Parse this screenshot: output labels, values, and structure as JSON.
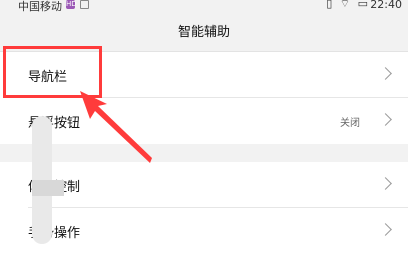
{
  "status_bar": {
    "carrier": "中国移动",
    "hd_badge": "HD",
    "right_icons": "▯ ⌔ ▭",
    "time": "22:40"
  },
  "page": {
    "title": "智能辅助"
  },
  "rows": [
    {
      "label": "导航栏",
      "value": ""
    },
    {
      "label": "悬浮按钮",
      "value": "关闭"
    },
    {
      "label": "体感控制",
      "value": ""
    },
    {
      "label": "手势操作",
      "value": ""
    }
  ],
  "annotation": {
    "highlight_color": "#ff3b3b",
    "arrow_color": "#ff3b3b"
  }
}
